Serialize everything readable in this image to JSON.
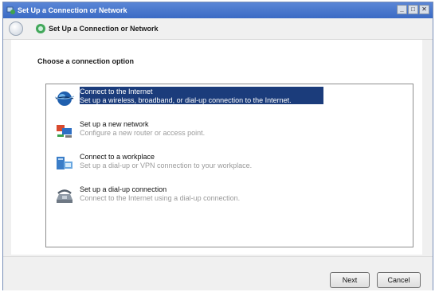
{
  "window": {
    "title": "Set Up a Connection or Network",
    "controls": [
      "minimize",
      "maximize",
      "close"
    ]
  },
  "nav": {
    "title": "Set Up a Connection or Network"
  },
  "content": {
    "heading": "Choose a connection option",
    "options": [
      {
        "title": "Connect to the Internet",
        "description": "Set up a wireless, broadband, or dial-up connection to the Internet.",
        "icon": "globe-icon",
        "selected": true
      },
      {
        "title": "Set up a new network",
        "description": "Configure a new router or access point.",
        "icon": "network-icon",
        "selected": false
      },
      {
        "title": "Connect to a workplace",
        "description": "Set up a dial-up or VPN connection to your workplace.",
        "icon": "workplace-icon",
        "selected": false
      },
      {
        "title": "Set up a dial-up connection",
        "description": "Connect to the Internet using a dial-up connection.",
        "icon": "phone-icon",
        "selected": false
      }
    ]
  },
  "buttons": {
    "next": "Next",
    "cancel": "Cancel"
  },
  "colors": {
    "selection": "#1b3c7b",
    "titlebar": "#3a6ac4"
  }
}
